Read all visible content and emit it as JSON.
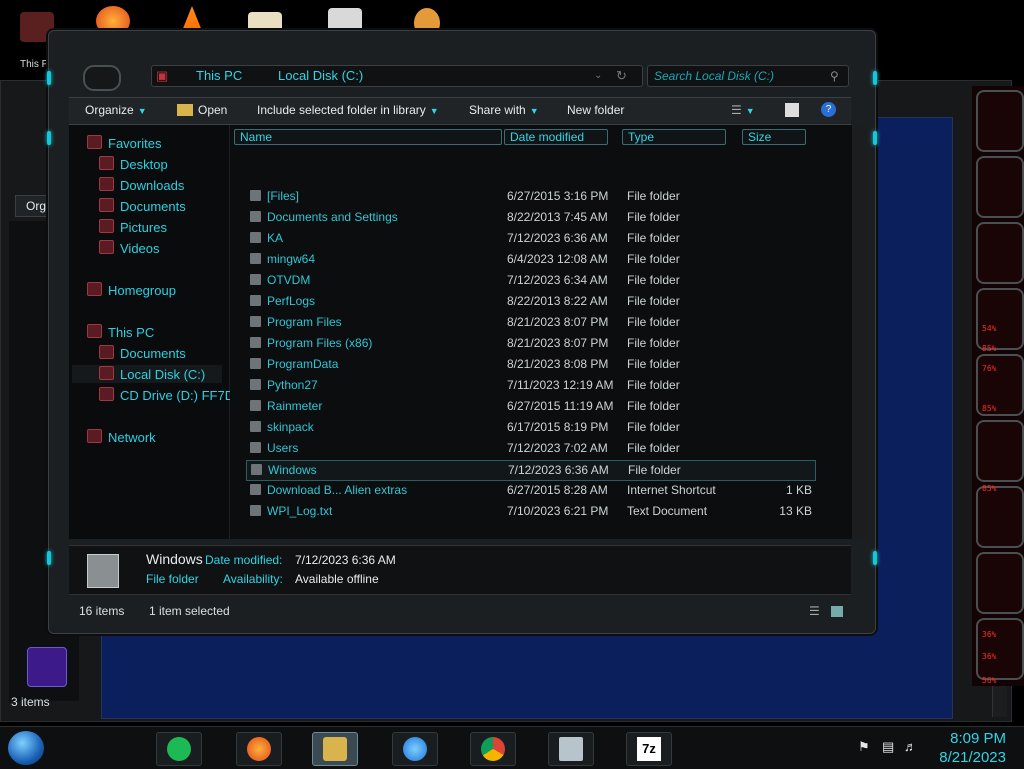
{
  "desktop": {
    "icon_label": "This P"
  },
  "bg_window": {
    "toolbar_label": "Orga",
    "status": "3 items",
    "alien_readouts": [
      "54%",
      "85%",
      "76%",
      "85%",
      "85%",
      "36%",
      "36%",
      "56%"
    ]
  },
  "explorer": {
    "breadcrumb": [
      "This PC",
      "Local Disk (C:)"
    ],
    "search_placeholder": "Search Local Disk (C:)",
    "toolbar": {
      "organize": "Organize",
      "open": "Open",
      "include": "Include selected folder in library",
      "share": "Share with",
      "new_folder": "New folder"
    },
    "nav": {
      "favorites": "Favorites",
      "desktop": "Desktop",
      "downloads": "Downloads",
      "documents": "Documents",
      "pictures": "Pictures",
      "videos": "Videos",
      "homegroup": "Homegroup",
      "this_pc": "This PC",
      "pc_documents": "Documents",
      "local_disk": "Local Disk (C:)",
      "cd_drive": "CD Drive (D:) FF7D",
      "network": "Network"
    },
    "columns": {
      "name": "Name",
      "date": "Date modified",
      "type": "Type",
      "size": "Size"
    },
    "files": [
      {
        "name": "[Files]",
        "date": "6/27/2015 3:16 PM",
        "type": "File folder",
        "size": ""
      },
      {
        "name": "Documents and Settings",
        "date": "8/22/2013 7:45 AM",
        "type": "File folder",
        "size": ""
      },
      {
        "name": "KA",
        "date": "7/12/2023 6:36 AM",
        "type": "File folder",
        "size": ""
      },
      {
        "name": "mingw64",
        "date": "6/4/2023 12:08 AM",
        "type": "File folder",
        "size": ""
      },
      {
        "name": "OTVDM",
        "date": "7/12/2023 6:34 AM",
        "type": "File folder",
        "size": ""
      },
      {
        "name": "PerfLogs",
        "date": "8/22/2013 8:22 AM",
        "type": "File folder",
        "size": ""
      },
      {
        "name": "Program Files",
        "date": "8/21/2023 8:07 PM",
        "type": "File folder",
        "size": ""
      },
      {
        "name": "Program Files (x86)",
        "date": "8/21/2023 8:07 PM",
        "type": "File folder",
        "size": ""
      },
      {
        "name": "ProgramData",
        "date": "8/21/2023 8:08 PM",
        "type": "File folder",
        "size": ""
      },
      {
        "name": "Python27",
        "date": "7/11/2023 12:19 AM",
        "type": "File folder",
        "size": ""
      },
      {
        "name": "Rainmeter",
        "date": "6/27/2015 11:19 AM",
        "type": "File folder",
        "size": ""
      },
      {
        "name": "skinpack",
        "date": "6/17/2015 8:19 PM",
        "type": "File folder",
        "size": ""
      },
      {
        "name": "Users",
        "date": "7/12/2023 7:02 AM",
        "type": "File folder",
        "size": ""
      },
      {
        "name": "Windows",
        "date": "7/12/2023 6:36 AM",
        "type": "File folder",
        "size": ""
      },
      {
        "name": "Download B... Alien extras",
        "date": "6/27/2015 8:28 AM",
        "type": "Internet Shortcut",
        "size": "1 KB"
      },
      {
        "name": "WPI_Log.txt",
        "date": "7/10/2023 6:21 PM",
        "type": "Text Document",
        "size": "13 KB"
      }
    ],
    "details": {
      "name": "Windows",
      "date_label": "Date modified:",
      "date_value": "7/12/2023 6:36 AM",
      "type": "File folder",
      "avail_label": "Availability:",
      "avail_value": "Available offline"
    },
    "status": {
      "items": "16 items",
      "selected": "1 item selected"
    }
  },
  "taskbar": {
    "time": "8:09 PM",
    "date": "8/21/2023"
  },
  "colors": {
    "accent": "#2ed6e6",
    "bg_panel": "#0b1f5c"
  }
}
